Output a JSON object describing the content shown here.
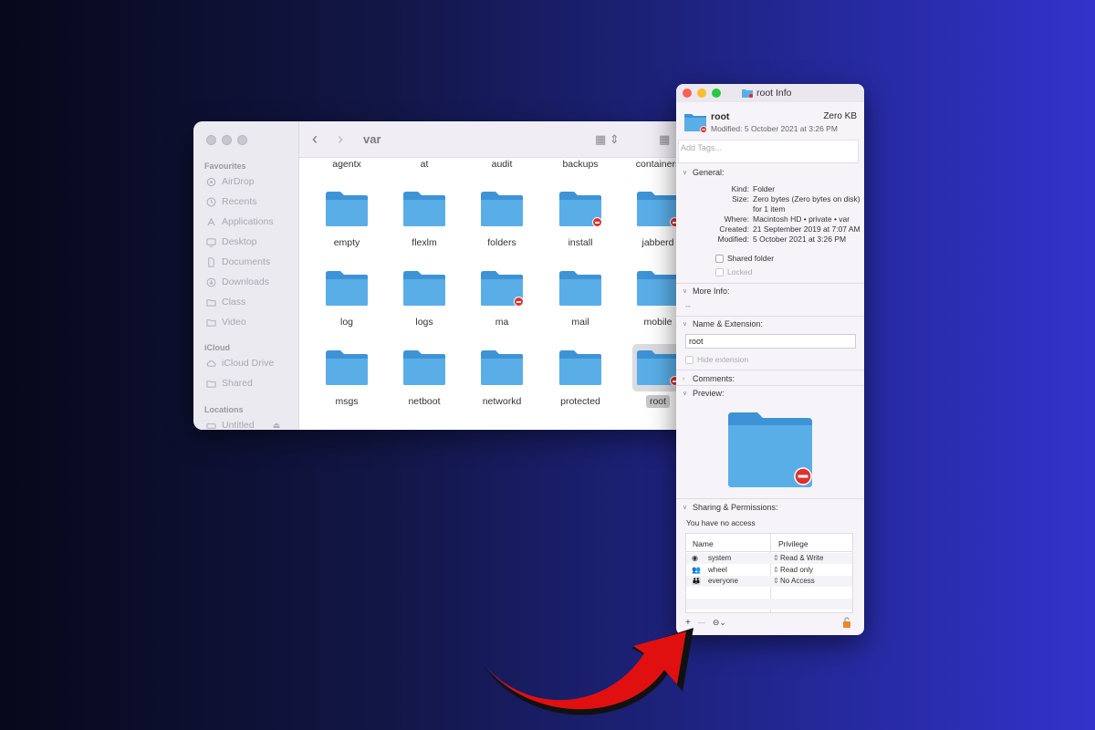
{
  "finder": {
    "path_title": "var",
    "sidebar": {
      "sections": [
        {
          "label": "Favourites",
          "items": [
            {
              "label": "AirDrop",
              "icon": "airdrop-icon"
            },
            {
              "label": "Recents",
              "icon": "clock-icon"
            },
            {
              "label": "Applications",
              "icon": "applications-icon"
            },
            {
              "label": "Desktop",
              "icon": "desktop-icon"
            },
            {
              "label": "Documents",
              "icon": "document-icon"
            },
            {
              "label": "Downloads",
              "icon": "download-icon"
            },
            {
              "label": "Class",
              "icon": "folder-icon"
            },
            {
              "label": "Video",
              "icon": "folder-icon"
            }
          ]
        },
        {
          "label": "iCloud",
          "items": [
            {
              "label": "iCloud Drive",
              "icon": "cloud-icon"
            },
            {
              "label": "Shared",
              "icon": "shared-folder-icon"
            }
          ]
        },
        {
          "label": "Locations",
          "items": [
            {
              "label": "Untitled",
              "icon": "disk-icon"
            }
          ]
        }
      ]
    },
    "top_row": [
      "agentx",
      "at",
      "audit",
      "backups",
      "containers"
    ],
    "rows": [
      [
        {
          "name": "empty",
          "restricted": false
        },
        {
          "name": "flexlm",
          "restricted": false
        },
        {
          "name": "folders",
          "restricted": false
        },
        {
          "name": "install",
          "restricted": true
        },
        {
          "name": "jabberd",
          "restricted": true
        }
      ],
      [
        {
          "name": "log",
          "restricted": false
        },
        {
          "name": "logs",
          "restricted": false
        },
        {
          "name": "ma",
          "restricted": true
        },
        {
          "name": "mail",
          "restricted": false
        },
        {
          "name": "mobile",
          "restricted": false
        }
      ],
      [
        {
          "name": "msgs",
          "restricted": false
        },
        {
          "name": "netboot",
          "restricted": false
        },
        {
          "name": "networkd",
          "restricted": false
        },
        {
          "name": "protected",
          "restricted": false
        },
        {
          "name": "root",
          "restricted": true,
          "selected": true
        }
      ]
    ]
  },
  "info": {
    "window_title": "root Info",
    "name": "root",
    "size_short": "Zero KB",
    "modified_short": "Modified: 5 October 2021 at 3:26 PM",
    "tags_placeholder": "Add Tags...",
    "general": {
      "header": "General:",
      "kind_label": "Kind:",
      "kind": "Folder",
      "size_label": "Size:",
      "size": "Zero bytes (Zero bytes on disk)",
      "size_items": "for 1 item",
      "where_label": "Where:",
      "where": "Macintosh HD • private • var",
      "created_label": "Created:",
      "created": "21 September 2019 at 7:07 AM",
      "modified_label": "Modified:",
      "modified": "5 October 2021 at 3:26 PM",
      "shared_folder": "Shared folder",
      "locked": "Locked"
    },
    "more_info": {
      "header": "More Info:",
      "value": "--"
    },
    "name_ext": {
      "header": "Name & Extension:",
      "value": "root",
      "hide_extension": "Hide extension"
    },
    "comments": {
      "header": "Comments:"
    },
    "preview": {
      "header": "Preview:"
    },
    "sharing": {
      "header": "Sharing & Permissions:",
      "status": "You have no access",
      "col_name": "Name",
      "col_privilege": "Privilege",
      "rows": [
        {
          "name": "system",
          "privilege": "Read & Write",
          "icon": "single-user-icon"
        },
        {
          "name": "wheel",
          "privilege": "Read only",
          "icon": "group-icon"
        },
        {
          "name": "everyone",
          "privilege": "No Access",
          "icon": "everyone-icon"
        }
      ],
      "add_label": "+",
      "remove_label": "—"
    }
  },
  "colors": {
    "folder": "#5aaee8",
    "folder_dark": "#3d93d6",
    "restricted": "#e0302c",
    "arrow": "#e01010"
  }
}
